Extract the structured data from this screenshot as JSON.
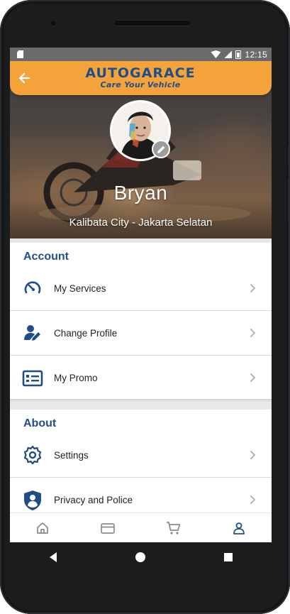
{
  "status_bar": {
    "time": "12:15"
  },
  "app_bar": {
    "brand": "AUTOGARACE",
    "tagline": "Care Your Vehicle"
  },
  "profile": {
    "name": "Bryan",
    "location": "Kalibata City  - Jakarta Selatan"
  },
  "sections": [
    {
      "title": "Account",
      "items": [
        {
          "label": "My Services",
          "icon": "speedometer-icon"
        },
        {
          "label": "Change Profile",
          "icon": "user-edit-icon"
        },
        {
          "label": "My Promo",
          "icon": "id-card-icon"
        }
      ]
    },
    {
      "title": "About",
      "items": [
        {
          "label": "Settings",
          "icon": "gear-icon"
        },
        {
          "label": "Privacy and Police",
          "icon": "shield-user-icon"
        }
      ]
    }
  ],
  "bottom_nav": [
    {
      "icon": "home-icon"
    },
    {
      "icon": "credit-card-icon"
    },
    {
      "icon": "cart-icon"
    },
    {
      "icon": "profile-icon",
      "active": true
    }
  ],
  "colors": {
    "accent_orange": "#f4a33b",
    "brand_blue": "#1e4f8a",
    "icon_blue": "#1f4e86"
  }
}
